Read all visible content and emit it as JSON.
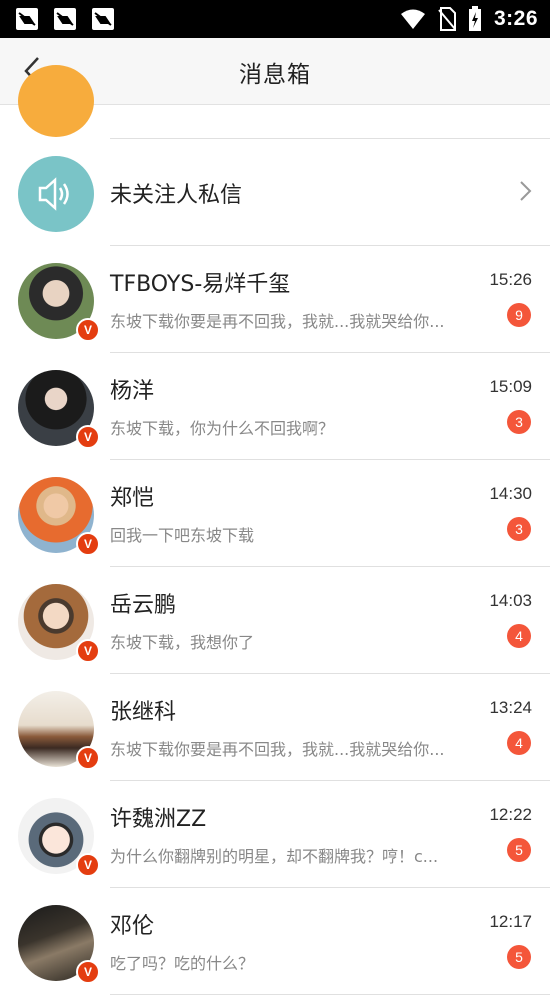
{
  "status_bar": {
    "time": "3:26",
    "icons": [
      "notification-icon",
      "notification-icon",
      "notification-icon",
      "wifi-icon",
      "no-sim-icon",
      "battery-charging-icon"
    ]
  },
  "header": {
    "title": "消息箱",
    "back_icon": "chevron-left-icon"
  },
  "stranger": {
    "label": "未关注人私信",
    "icon": "speaker-icon"
  },
  "conversations": [
    {
      "name": "TFBOYS-易烊千玺",
      "time": "15:26",
      "message": "东坡下载你要是再不回我，我就...我就哭给你...",
      "count": "9",
      "badge": "V"
    },
    {
      "name": "杨洋",
      "time": "15:09",
      "message": "东坡下载，你为什么不回我啊？",
      "count": "3",
      "badge": "V"
    },
    {
      "name": "郑恺",
      "time": "14:30",
      "message": "回我一下吧东坡下载",
      "count": "3",
      "badge": "V"
    },
    {
      "name": "岳云鹏",
      "time": "14:03",
      "message": "东坡下载，我想你了",
      "count": "4",
      "badge": "V"
    },
    {
      "name": "张继科",
      "time": "13:24",
      "message": "东坡下载你要是再不回我，我就...我就哭给你...",
      "count": "4",
      "badge": "V"
    },
    {
      "name": "许魏洲ZZ",
      "time": "12:22",
      "message": "为什么你翻牌别的明星，却不翻牌我？哼！c...",
      "count": "5",
      "badge": "V"
    },
    {
      "name": "邓伦",
      "time": "12:17",
      "message": "吃了吗？吃的什么？",
      "count": "5",
      "badge": "V"
    }
  ],
  "colors": {
    "status_bar": "#000000",
    "header_bg": "#f7f7f7",
    "unread_badge": "#f4563a",
    "verified_badge": "#e43d10",
    "stranger_avatar": "#7ac4c7",
    "partial_avatar": "#f7ac3d"
  }
}
